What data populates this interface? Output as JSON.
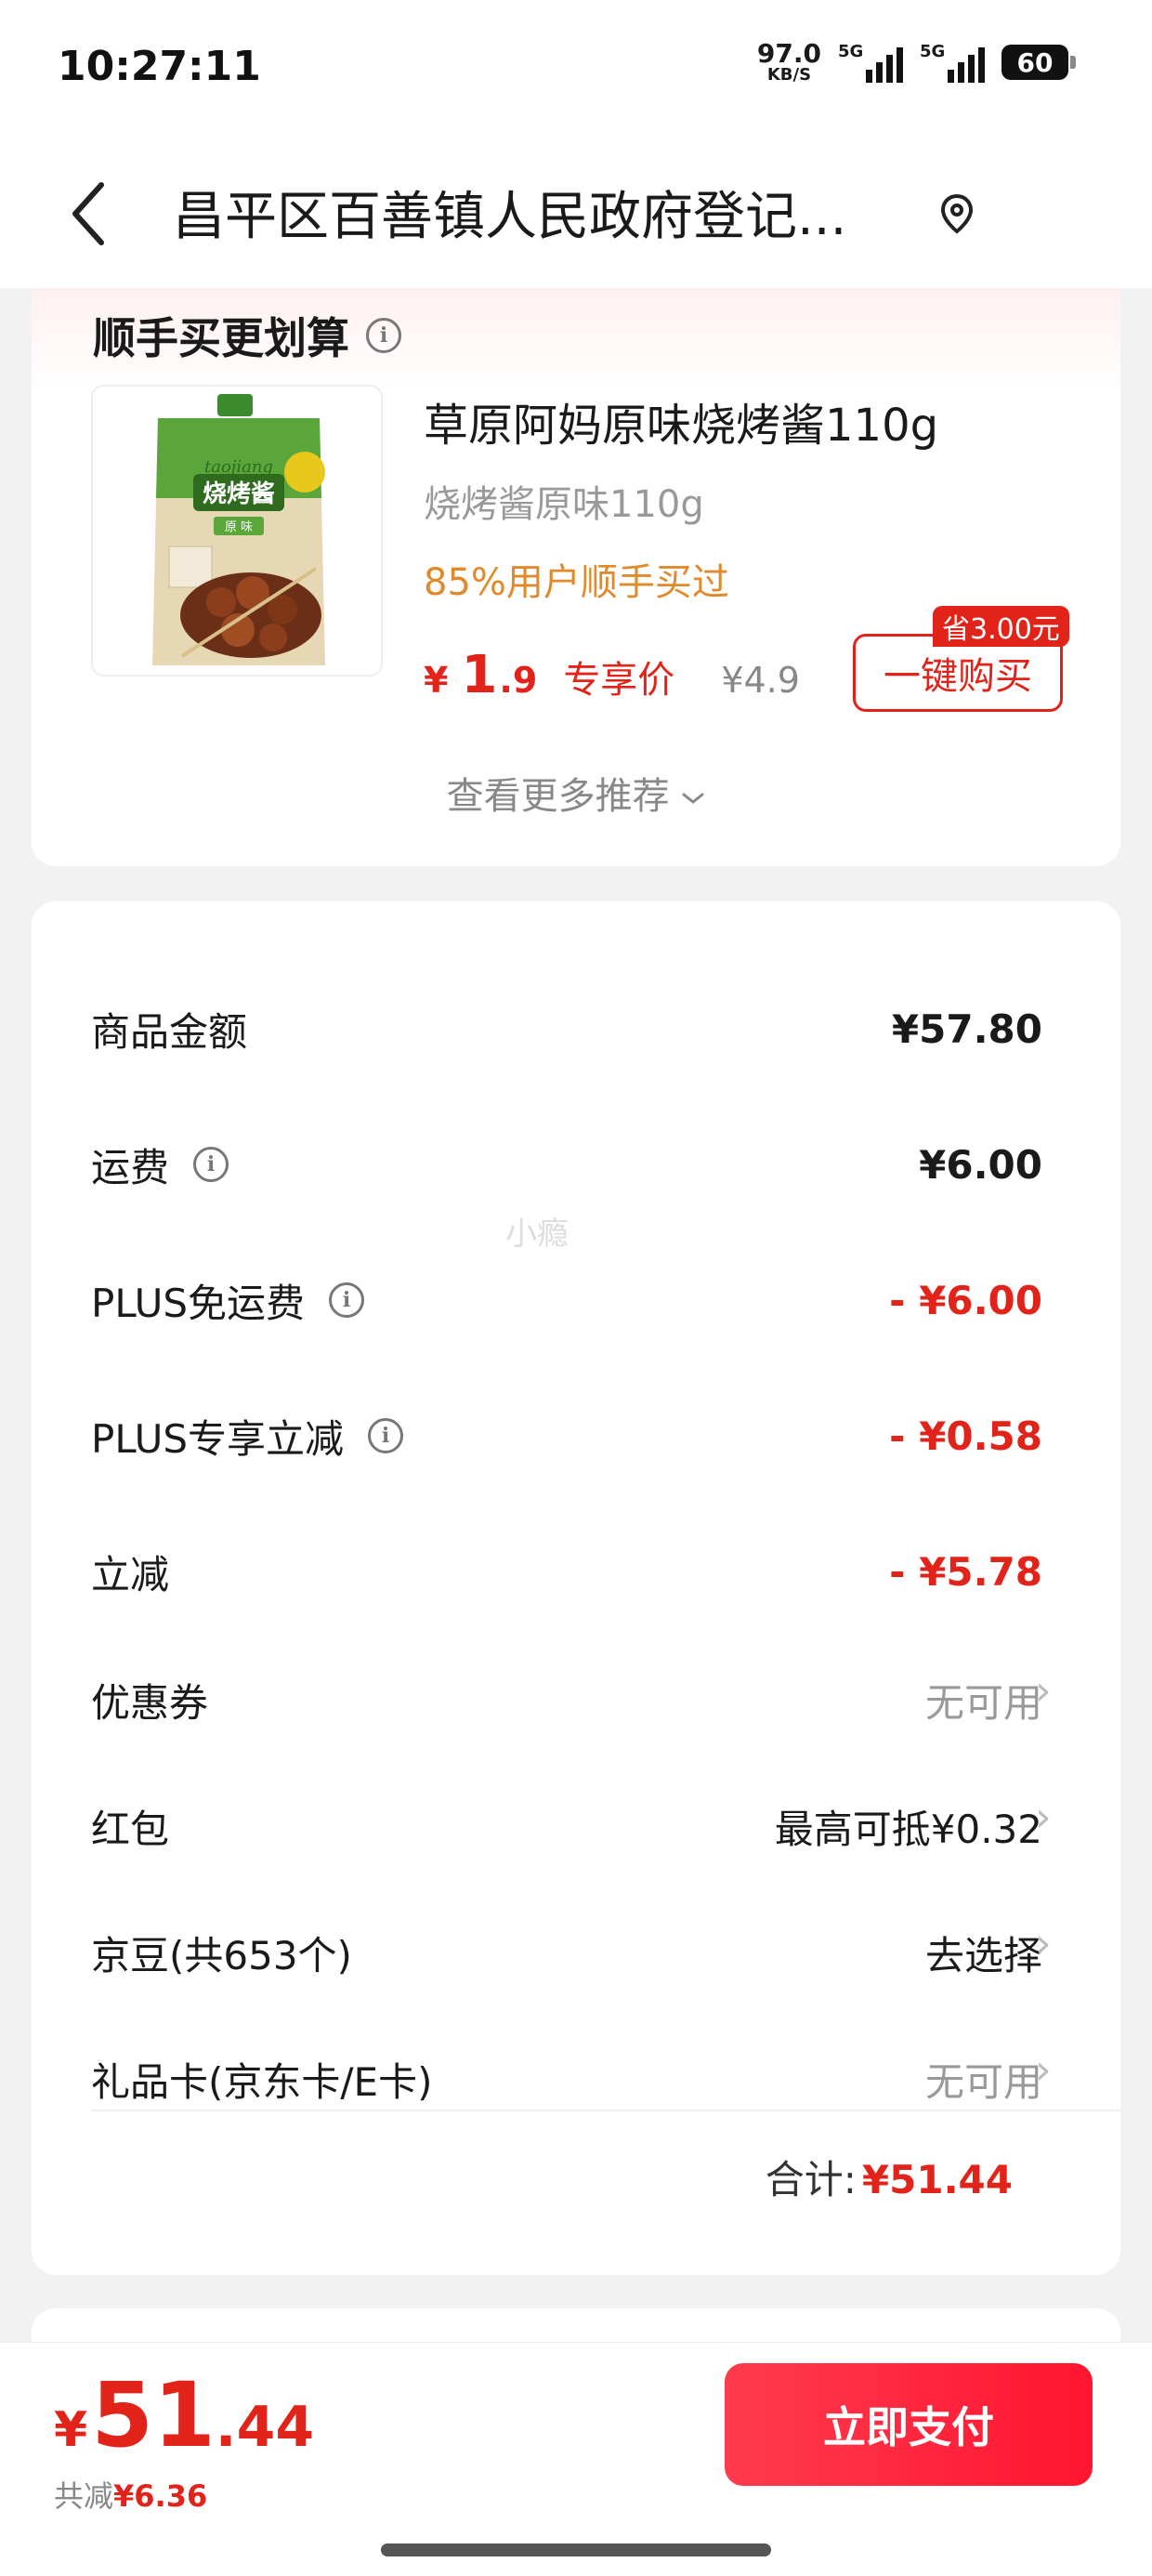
{
  "status_bar": {
    "time": "10:27:11",
    "net_speed_value": "97.0",
    "net_speed_unit": "KB/S",
    "signal1_label": "5G",
    "signal2_label": "5G",
    "battery": "60"
  },
  "header": {
    "title": "昌平区百善镇人民政府登记...",
    "back_icon": "chevron-left-icon",
    "location_icon": "location-pin-icon"
  },
  "recommend": {
    "title": "顺手买更划算",
    "product": {
      "name": "草原阿妈原味烧烤酱110g",
      "spec": "烧烤酱原味110g",
      "hint": "85%用户顺手买过",
      "price_currency": "¥",
      "price_int": "1",
      "price_dec": ".9",
      "price_tag": "专享价",
      "original_price": "¥4.9",
      "save_badge": "省3.00元",
      "buy_label": "一键购买",
      "image_text_brand": "taojiang",
      "image_text_name": "烧烤酱",
      "image_text_flavor": "原 味"
    },
    "more_label": "查看更多推荐"
  },
  "costs": {
    "watermark": "小瘾",
    "goods_amount_label": "商品金额",
    "goods_amount": "¥57.80",
    "shipping_label": "运费",
    "shipping": "¥6.00",
    "plus_free_shipping_label": "PLUS免运费",
    "plus_free_shipping": "- ¥6.00",
    "plus_discount_label": "PLUS专享立减",
    "plus_discount": "- ¥0.58",
    "instant_discount_label": "立减",
    "instant_discount": "- ¥5.78",
    "coupon_label": "优惠券",
    "coupon_value": "无可用",
    "red_packet_label": "红包",
    "red_packet_value": "最高可抵¥0.32",
    "jd_beans_label": "京豆(共653个)",
    "jd_beans_value": "去选择",
    "gift_card_label": "礼品卡(京东卡/E卡)",
    "gift_card_value": "无可用",
    "total_label": "合计:",
    "total_value": "¥51.44"
  },
  "bottom": {
    "currency": "¥",
    "price_int": "51",
    "price_dec": ".44",
    "saved_label": "共减",
    "saved_value": "¥6.36",
    "pay_label": "立即支付"
  },
  "colors": {
    "accent": "#e2231a",
    "hint": "#e08a2c",
    "pay_button": "#ff1530"
  }
}
